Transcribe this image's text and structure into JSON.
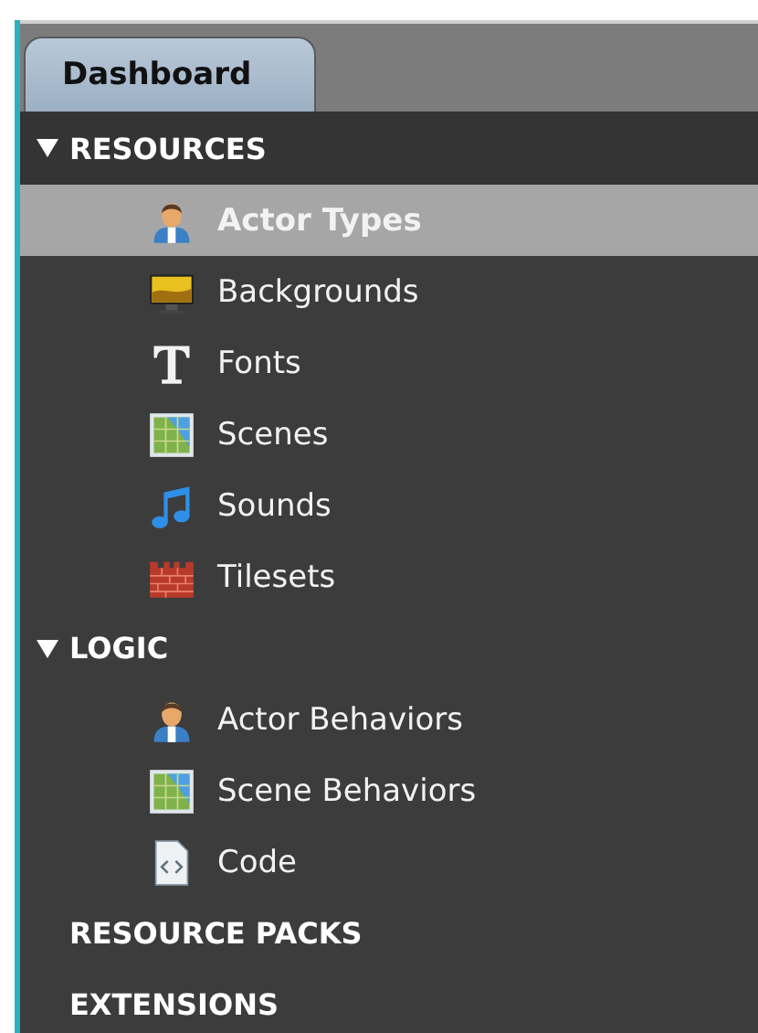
{
  "tabs": [
    {
      "label": "Dashboard",
      "selected": true
    }
  ],
  "sections": [
    {
      "label": "RESOURCES",
      "expanded": true,
      "children": [
        {
          "label": "Actor Types",
          "kind": "actor",
          "selected": true
        },
        {
          "label": "Backgrounds",
          "kind": "background",
          "selected": false
        },
        {
          "label": "Fonts",
          "kind": "font",
          "selected": false
        },
        {
          "label": "Scenes",
          "kind": "scene",
          "selected": false
        },
        {
          "label": "Sounds",
          "kind": "sound",
          "selected": false
        },
        {
          "label": "Tilesets",
          "kind": "tileset",
          "selected": false
        }
      ]
    },
    {
      "label": "LOGIC",
      "expanded": true,
      "children": [
        {
          "label": "Actor Behaviors",
          "kind": "actor",
          "selected": false
        },
        {
          "label": "Scene Behaviors",
          "kind": "scene",
          "selected": false
        },
        {
          "label": "Code",
          "kind": "code",
          "selected": false
        }
      ]
    },
    {
      "label": "RESOURCE PACKS",
      "expanded": false
    },
    {
      "label": "EXTENSIONS",
      "expanded": false
    }
  ]
}
